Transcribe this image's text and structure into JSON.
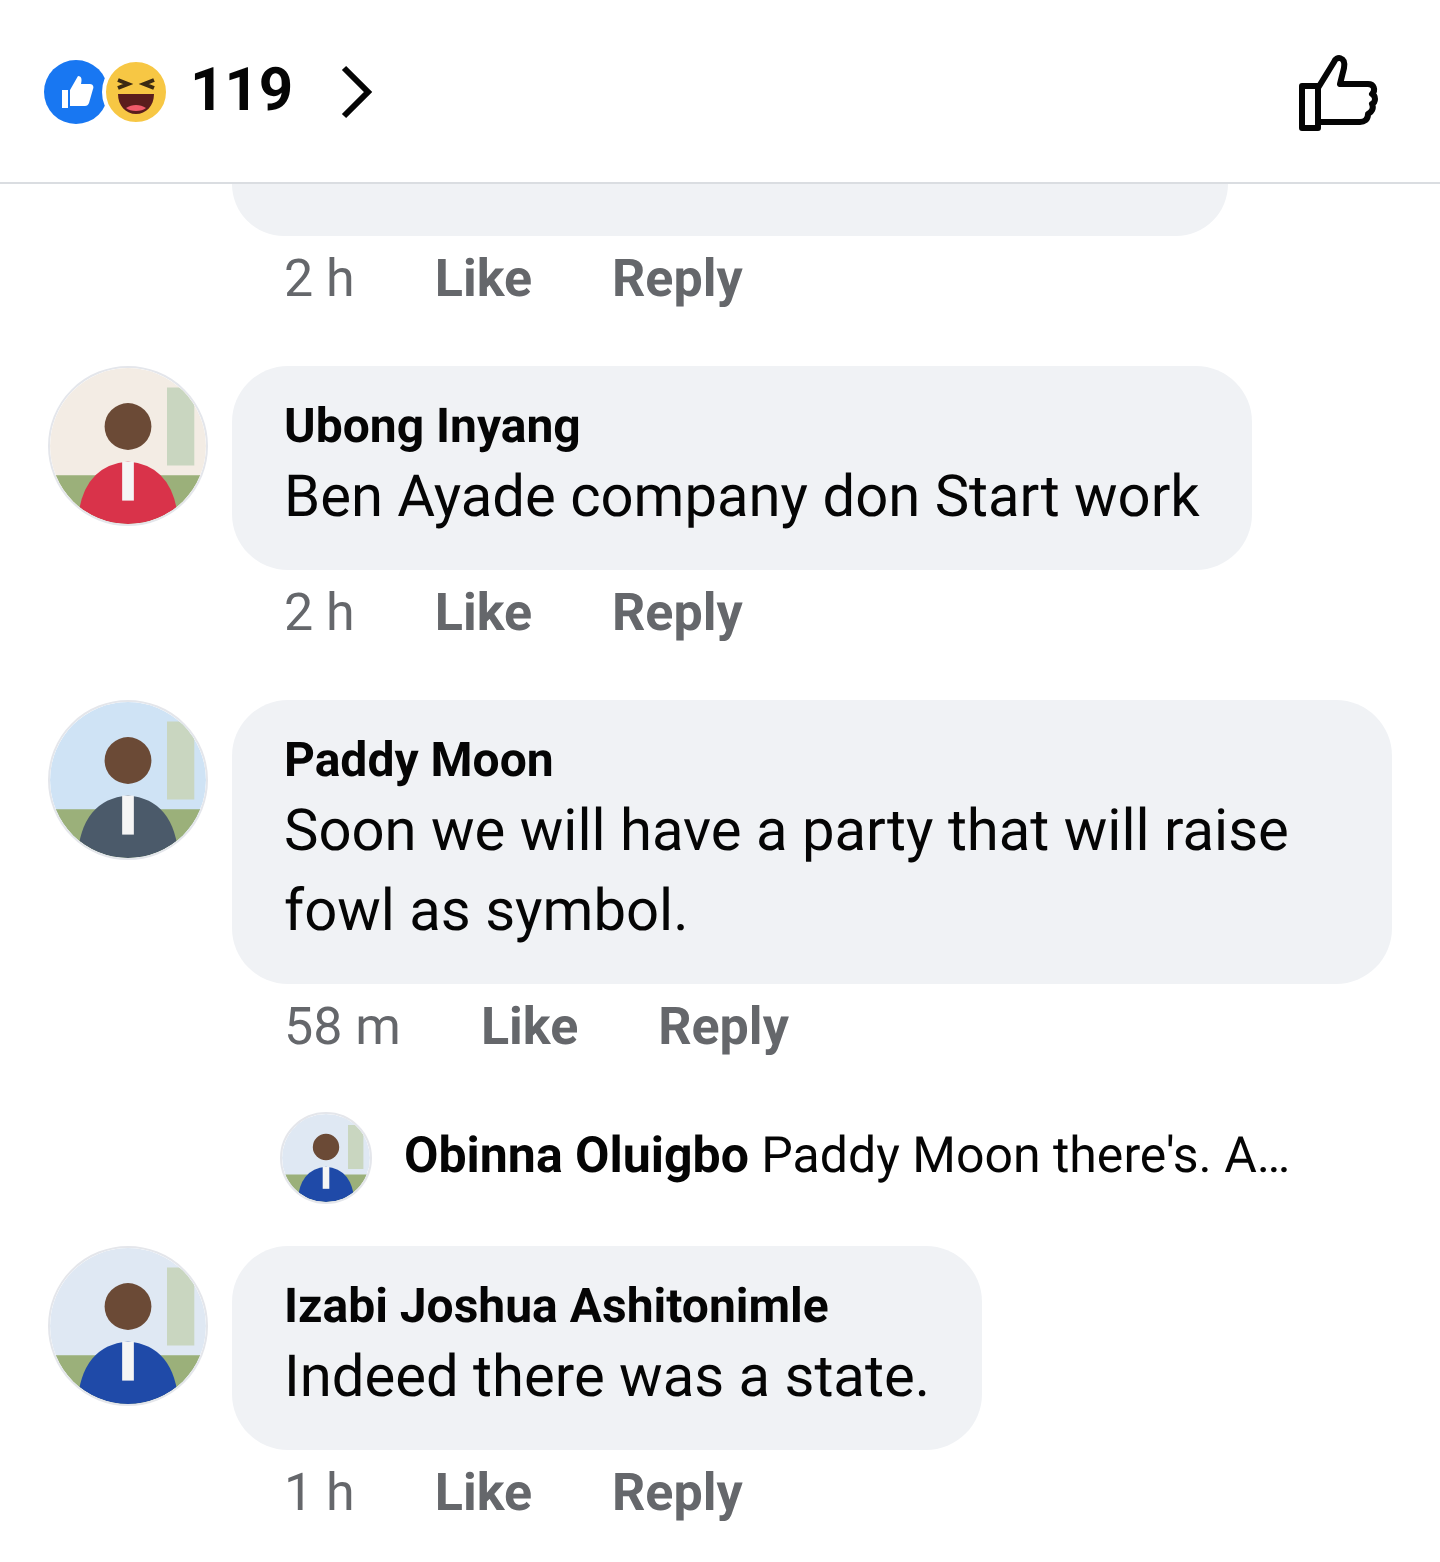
{
  "header": {
    "count": "119"
  },
  "comments": [
    {
      "kind": "cut",
      "time": "2 h",
      "actions": [
        "Like",
        "Reply"
      ]
    },
    {
      "kind": "comment",
      "author": "Ubong Inyang",
      "text": "Ben Ayade company don Start work",
      "time": "2 h",
      "actions": [
        "Like",
        "Reply"
      ]
    },
    {
      "kind": "comment",
      "author": "Paddy Moon",
      "text": "Soon we will have a party that will raise fowl as symbol.",
      "time": "58 m",
      "actions": [
        "Like",
        "Reply"
      ],
      "reply": {
        "author": "Obinna Oluigbo",
        "text": "Paddy Moon there's. A…"
      }
    },
    {
      "kind": "comment",
      "author": "Izabi Joshua Ashitonimle",
      "text": "Indeed there was a state.",
      "time": "1 h",
      "actions": [
        "Like",
        "Reply"
      ]
    }
  ]
}
